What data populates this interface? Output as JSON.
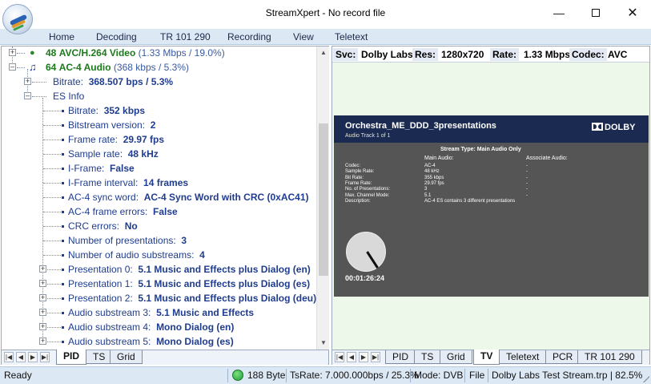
{
  "window": {
    "title": "StreamXpert - No record file",
    "min_icon": "minimize-icon",
    "max_icon": "maximize-icon",
    "close_icon": "close-icon"
  },
  "menu": [
    "Home",
    "Decoding",
    "TR 101 290",
    "Recording",
    "View",
    "Teletext"
  ],
  "tree": {
    "video": {
      "pid": "48",
      "name": "AVC/H.264 Video",
      "info": "(1.33 Mbps / 19.0%)"
    },
    "audio": {
      "pid": "64",
      "name": "AC-4 Audio",
      "info": "(368 kbps / 5.3%)"
    },
    "bitrate": {
      "label": "Bitrate:",
      "value": "368.507 bps / 5.3%"
    },
    "es_info": "ES Info",
    "es_items": [
      {
        "label": "Bitrate:",
        "value": "352 kbps"
      },
      {
        "label": "Bitstream version:",
        "value": "2"
      },
      {
        "label": "Frame rate:",
        "value": "29.97 fps"
      },
      {
        "label": "Sample rate:",
        "value": "48 kHz"
      },
      {
        "label": "I-Frame:",
        "value": "False"
      },
      {
        "label": "I-Frame interval:",
        "value": "14 frames"
      },
      {
        "label": "AC-4 sync word:",
        "value": "AC-4 Sync Word with CRC (0xAC41)"
      },
      {
        "label": "AC-4 frame errors:",
        "value": "False"
      },
      {
        "label": "CRC errors:",
        "value": "No"
      },
      {
        "label": "Number of presentations:",
        "value": "3"
      },
      {
        "label": "Number of audio substreams:",
        "value": "4"
      }
    ],
    "expandable_items": [
      {
        "label": "Presentation 0:",
        "value": "5.1 Music and Effects plus Dialog (en)"
      },
      {
        "label": "Presentation 1:",
        "value": "5.1 Music and Effects plus Dialog (es)"
      },
      {
        "label": "Presentation 2:",
        "value": "5.1 Music and Effects plus Dialog (deu)"
      },
      {
        "label": "Audio substream 3:",
        "value": "5.1 Music and Effects"
      },
      {
        "label": "Audio substream 4:",
        "value": "Mono Dialog (en)"
      },
      {
        "label": "Audio substream 5:",
        "value": "Mono Dialog (es)"
      }
    ]
  },
  "left_tabs": [
    "PID",
    "TS",
    "Grid"
  ],
  "left_active_tab": "PID",
  "right_tabs": [
    "PID",
    "TS",
    "Grid",
    "TV",
    "Teletext",
    "PCR",
    "TR 101 290"
  ],
  "right_active_tab": "TV",
  "info_bar": {
    "svc_label": "Svc:",
    "svc_value": "Dolby Labs",
    "res_label": "Res:",
    "res_value": "1280x720",
    "rate_label": "Rate:",
    "rate_value": "1.33 Mbps",
    "codec_label": "Codec:",
    "codec_value": "AVC"
  },
  "tv": {
    "program": "Orchestra_ME_DDD_3presentations",
    "track": "Audio Track 1 of 1",
    "brand": "DOLBY",
    "stream_type": "Stream Type: Main Audio Only",
    "main_audio_header": "Main Audio:",
    "assoc_audio_header": "Associate Audio:",
    "rows": [
      {
        "k": "Codec:",
        "m": "AC-4",
        "a": "-"
      },
      {
        "k": "Sample Rate:",
        "m": "48 kHz",
        "a": "-"
      },
      {
        "k": "Bit Rate:",
        "m": "355 kbps",
        "a": "-"
      },
      {
        "k": "Frame Rate:",
        "m": "29.97 fps",
        "a": "-"
      },
      {
        "k": "No. of Presentations:",
        "m": "3",
        "a": "-"
      },
      {
        "k": "Max. Channel Mode:",
        "m": "5.1",
        "a": "-"
      },
      {
        "k": "Description:",
        "m": "AC-4 ES contains 3 different presentations",
        "a": ""
      }
    ],
    "timecode": "00:01:26:24"
  },
  "status": {
    "ready": "Ready",
    "bytes": "188 Byte",
    "ts_rate": "TsRate: 7.000.000bps / 25.3%",
    "mode": "Mode: DVB",
    "file": "File",
    "stream": "Dolby Labs Test Stream.trp | 82.5%"
  }
}
